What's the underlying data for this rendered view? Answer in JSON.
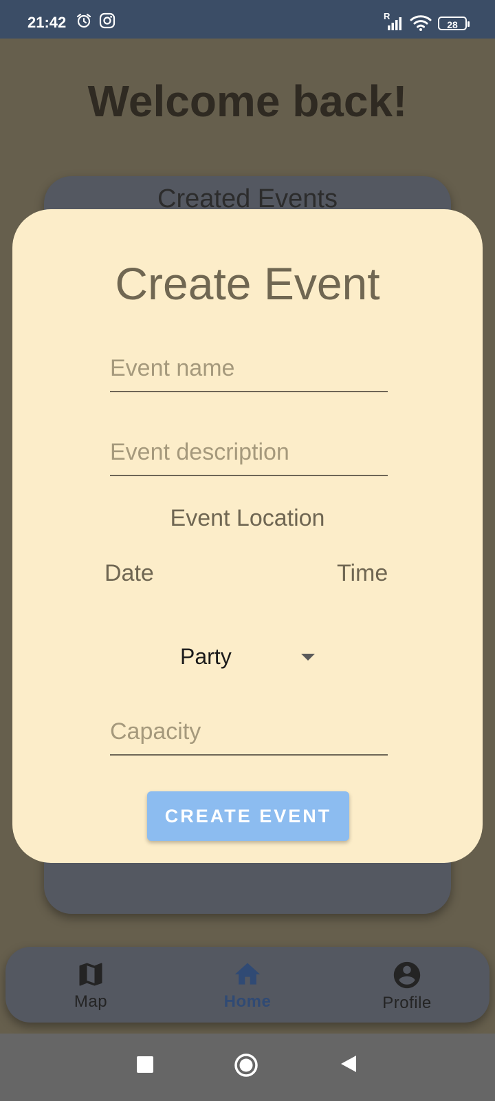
{
  "status_bar": {
    "time": "21:42",
    "icons": [
      "alarm-icon",
      "instagram-icon",
      "signal-icon",
      "wifi-icon"
    ],
    "signal_label": "R",
    "battery": "28"
  },
  "home": {
    "welcome": "Welcome back!",
    "created_events_title": "Created Events"
  },
  "dialog": {
    "title": "Create Event",
    "event_name_placeholder": "Event name",
    "event_description_placeholder": "Event description",
    "event_location_label": "Event Location",
    "date_label": "Date",
    "time_label": "Time",
    "category_selected": "Party",
    "capacity_placeholder": "Capacity",
    "submit_label": "CREATE EVENT"
  },
  "bottom_nav": {
    "items": [
      {
        "label": "Map",
        "icon": "map-icon"
      },
      {
        "label": "Home",
        "icon": "home-icon",
        "active": true
      },
      {
        "label": "Profile",
        "icon": "profile-icon"
      }
    ]
  },
  "colors": {
    "status_bar": "#3b4d66",
    "background_dim": "#665f4d",
    "card": "#545861",
    "dialog": "#fcedc9",
    "primary_button": "#8cbcf0",
    "nav_active": "#304a74"
  }
}
